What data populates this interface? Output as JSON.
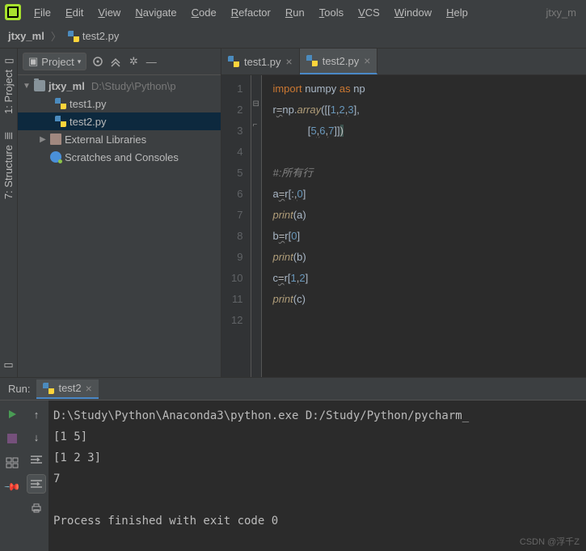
{
  "menu": {
    "items": [
      "File",
      "Edit",
      "View",
      "Navigate",
      "Code",
      "Refactor",
      "Run",
      "Tools",
      "VCS",
      "Window",
      "Help"
    ],
    "title_right": "jtxy_m"
  },
  "breadcrumb": {
    "project": "jtxy_ml",
    "file": "test2.py"
  },
  "sidebar_tabs": {
    "project": "1: Project",
    "structure": "7: Structure"
  },
  "project_pane": {
    "title": "Project",
    "root": {
      "name": "jtxy_ml",
      "path": "D:\\Study\\Python\\p"
    },
    "files": [
      "test1.py",
      "test2.py"
    ],
    "external": "External Libraries",
    "scratches": "Scratches and Consoles"
  },
  "editor": {
    "tabs": [
      {
        "label": "test1.py",
        "active": false
      },
      {
        "label": "test2.py",
        "active": true
      }
    ],
    "code_tokens": [
      [
        [
          "kw",
          "import"
        ],
        [
          "op",
          " "
        ],
        [
          "id",
          "numpy"
        ],
        [
          "op",
          " "
        ],
        [
          "kw",
          "as"
        ],
        [
          "op",
          " "
        ],
        [
          "id",
          "np"
        ]
      ],
      [
        [
          "id",
          "r"
        ],
        [
          "wavy",
          "="
        ],
        [
          "id",
          "np"
        ],
        [
          "op",
          "."
        ],
        [
          "fn",
          "array"
        ],
        [
          "op",
          "([["
        ],
        [
          "num",
          "1"
        ],
        [
          "wavy",
          ","
        ],
        [
          "num",
          "2"
        ],
        [
          "wavy",
          ","
        ],
        [
          "num",
          "3"
        ],
        [
          "op",
          "],"
        ]
      ],
      [
        [
          "op",
          "            ["
        ],
        [
          "num",
          "5"
        ],
        [
          "wavy",
          ","
        ],
        [
          "num",
          "6"
        ],
        [
          "wavy",
          ","
        ],
        [
          "num",
          "7"
        ],
        [
          "op",
          "]]"
        ],
        [
          "par-hi",
          ")"
        ]
      ],
      [],
      [
        [
          "cmt",
          "#:所有行"
        ]
      ],
      [
        [
          "id",
          "a"
        ],
        [
          "wavy",
          "="
        ],
        [
          "id",
          "r"
        ],
        [
          "op",
          "[:"
        ],
        [
          "wavy",
          ","
        ],
        [
          "num",
          "0"
        ],
        [
          "op",
          "]"
        ]
      ],
      [
        [
          "fn",
          "print"
        ],
        [
          "op",
          "("
        ],
        [
          "id",
          "a"
        ],
        [
          "op",
          ")"
        ]
      ],
      [
        [
          "id",
          "b"
        ],
        [
          "wavy",
          "="
        ],
        [
          "id",
          "r"
        ],
        [
          "op",
          "["
        ],
        [
          "num",
          "0"
        ],
        [
          "op",
          "]"
        ]
      ],
      [
        [
          "fn",
          "print"
        ],
        [
          "op",
          "("
        ],
        [
          "id",
          "b"
        ],
        [
          "op",
          ")"
        ]
      ],
      [
        [
          "id",
          "c"
        ],
        [
          "wavy",
          "="
        ],
        [
          "id",
          "r"
        ],
        [
          "op",
          "["
        ],
        [
          "num",
          "1"
        ],
        [
          "wavy",
          ","
        ],
        [
          "num",
          "2"
        ],
        [
          "op",
          "]"
        ]
      ],
      [
        [
          "fn",
          "print"
        ],
        [
          "op",
          "("
        ],
        [
          "id",
          "c"
        ],
        [
          "op",
          ")"
        ]
      ],
      []
    ]
  },
  "run": {
    "title": "Run:",
    "config": "test2",
    "output": "D:\\Study\\Python\\Anaconda3\\python.exe D:/Study/Python/pycharm_\n[1 5]\n[1 2 3]\n7\n\nProcess finished with exit code 0"
  },
  "watermark": "CSDN @浮千Z"
}
